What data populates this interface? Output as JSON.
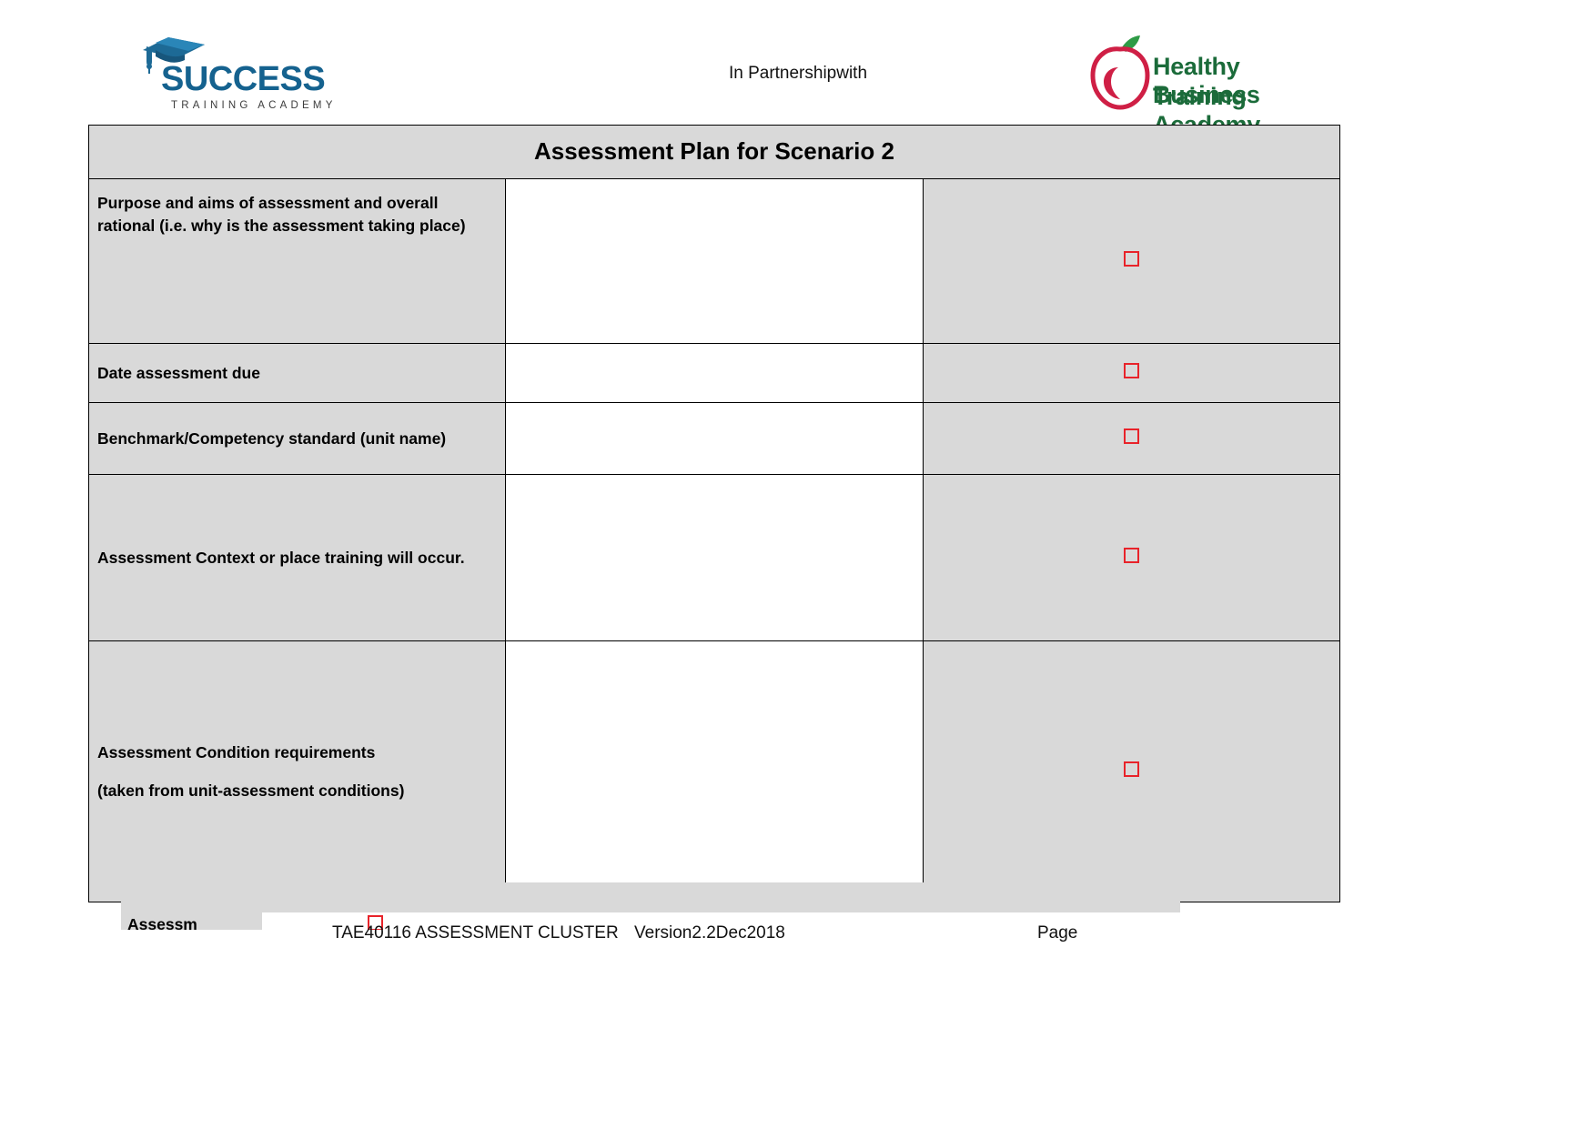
{
  "header": {
    "partnership_text": "In Partnershipwith",
    "left_logo": {
      "name": "success-training-academy-logo",
      "wordmark": "SUCCESS",
      "subwordmark": "TRAINING ACADEMY",
      "color": "#15628f",
      "icon": "graduation-cap-icon"
    },
    "right_logo": {
      "name": "healthy-business-training-academy-logo",
      "line1": "Healthy Business",
      "line2": "Training Academy",
      "text_color": "#1b6b3a",
      "apple_color": "#cf1f45",
      "leaf_color": "#2e9b46",
      "icon": "apple-icon"
    }
  },
  "table": {
    "title": "Assessment Plan for Scenario 2",
    "header_bg": "#d9d9d9",
    "checkbox_color": "#e8232a",
    "rows": [
      {
        "label": "Purpose and aims of assessment and overall rational (i.e. why is the assessment taking place)",
        "value": "",
        "checked": false
      },
      {
        "label": "Date assessment due",
        "value": "",
        "checked": false
      },
      {
        "label": "Benchmark/Competency standard (unit name)",
        "value": "",
        "checked": false
      },
      {
        "label": "Assessment Context or place training will occur.",
        "value": "",
        "checked": false
      },
      {
        "label": "Assessment Condition requirements",
        "label_sub": "(taken from unit-assessment conditions)",
        "value": "",
        "checked": false
      }
    ]
  },
  "clipped_artifact": {
    "label": "Assessm",
    "checked": false
  },
  "footer": {
    "cluster": "TAE40116 ASSESSMENT CLUSTER",
    "version": "Version2.2Dec2018",
    "page": "Page"
  }
}
